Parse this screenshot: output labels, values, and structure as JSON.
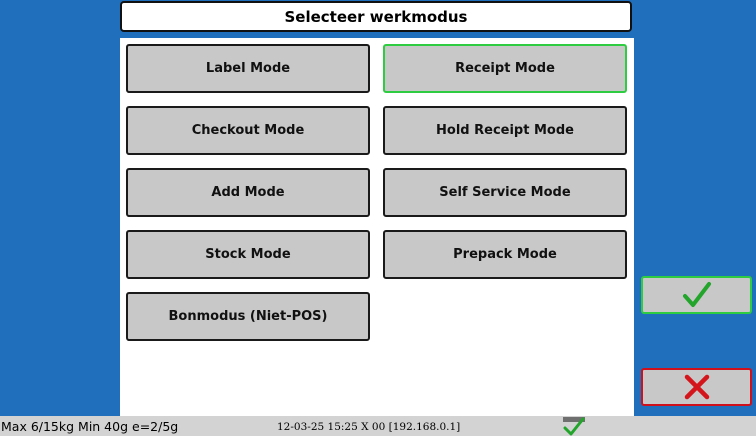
{
  "dialog": {
    "title": "Selecteer werkmodus"
  },
  "modes": [
    {
      "label": "Label Mode",
      "selected": false
    },
    {
      "label": "Receipt Mode",
      "selected": true
    },
    {
      "label": "Checkout Mode",
      "selected": false
    },
    {
      "label": "Hold Receipt Mode",
      "selected": false
    },
    {
      "label": "Add Mode",
      "selected": false
    },
    {
      "label": "Self Service Mode",
      "selected": false
    },
    {
      "label": "Stock Mode",
      "selected": false
    },
    {
      "label": "Prepack Mode",
      "selected": false
    },
    {
      "label": "Bonmodus (Niet-POS)",
      "selected": false
    }
  ],
  "side_buttons": {
    "confirm_icon": "checkmark-icon",
    "cancel_icon": "close-icon"
  },
  "status": {
    "scale_info": "Max 6/15kg Min 40g e=2/5g",
    "datetime_info": "12-03-25 15:25 X 00 [192.168.0.1]",
    "indicator_icon": "checkmark-icon"
  },
  "colors": {
    "background": "#1f6fbc",
    "selected_border": "#2ecc40",
    "cancel_border": "#d0101a",
    "check": "#22a52a",
    "cross": "#d4161c"
  }
}
